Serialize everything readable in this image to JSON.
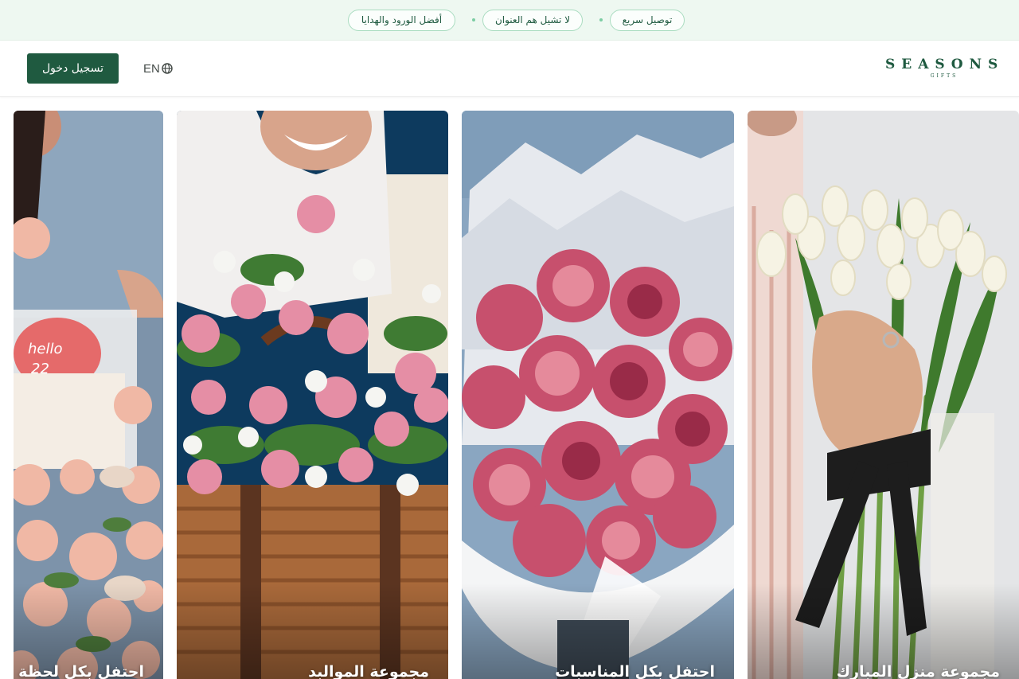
{
  "announcements": [
    "توصيل سريع",
    "لا تشيل هم العنوان",
    "أفضل الورود والهدايا"
  ],
  "header": {
    "login_label": "تسجيل دخول",
    "language_label": "EN",
    "logo_text": "SEASONS",
    "logo_subtext": "GIFTS"
  },
  "icons": {
    "language": "globe-icon"
  },
  "colors": {
    "brand": "#1f5a40",
    "announcement_bg": "#eef8f1",
    "pill_border": "#a9dcc0"
  },
  "collections": [
    {
      "title": "مجموعة منزل المبارك"
    },
    {
      "title": "احتفل بكل المناسبات"
    },
    {
      "title": "مجموعة الموالبد"
    },
    {
      "title": "احتفل بكل لحظة"
    }
  ]
}
